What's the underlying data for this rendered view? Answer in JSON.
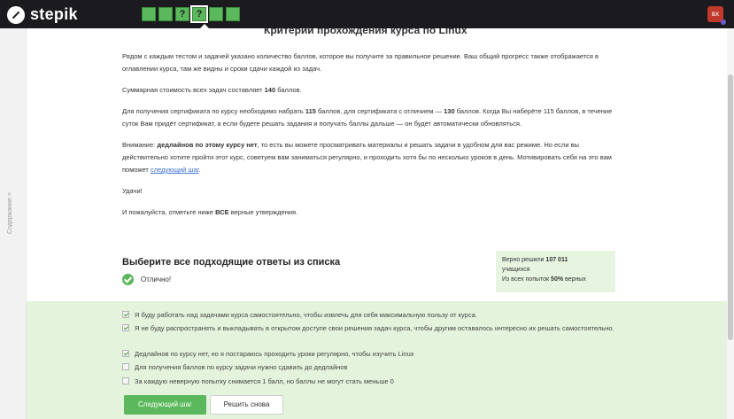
{
  "app": {
    "logo_text": "stepik",
    "avatar_initials": "вх"
  },
  "steps": [
    {
      "label": "",
      "active": false
    },
    {
      "label": "",
      "active": false
    },
    {
      "label": "?",
      "active": false
    },
    {
      "label": "?",
      "active": true
    },
    {
      "label": "",
      "active": false
    },
    {
      "label": "",
      "active": false
    }
  ],
  "sidebar": {
    "label": "Содержание >"
  },
  "lesson": {
    "title": "Критерии прохождения курса по Linux",
    "p1": "Рядом с каждым тестом и задачей указано количество баллов, которое вы получите за правильное решение. Ваш общий прогресс также отображается в оглавлении курса, там же видны и сроки сдачи каждой из задач.",
    "p2_a": "Суммарная стоимость всех задач составляет ",
    "p2_b": "140",
    "p2_c": " баллов.",
    "p3_a": "Для получения сертификата по курсу необходимо набрать ",
    "p3_b": "115",
    "p3_c": " баллов, для сертификата с отличием — ",
    "p3_d": "130",
    "p3_e": " баллов. Когда Вы наберёте 115 баллов, в течение суток Вам придёт сертификат, а если будете решать задания и получать баллы дальше — он будет автоматически обновляться.",
    "p4_a": "Внимание: ",
    "p4_b": "дедлайнов по этому курсу нет",
    "p4_c": ", то есть вы можете просматривать материалы и решать задачи в удобном для вас режиме. Но если вы действительно хотите пройти этот курс, советуем вам заниматься регулярно, и проходить хотя бы по несколько уроков в день. Мотивировать себя на это вам поможет ",
    "p4_link": "следующий шаг",
    "p4_d": ".",
    "p5": "Удачи!",
    "p6_a": "И пожалуйста, отметьте ниже ",
    "p6_b": "ВСЕ",
    "p6_c": " верные утверждения."
  },
  "quiz": {
    "heading": "Выберите все подходящие ответы из списка",
    "result": "Отлично!",
    "stats_a": "Верно решили ",
    "stats_b": "107 011",
    "stats_c": "учащихся",
    "stats_d": "Из всех попыток ",
    "stats_e": "50%",
    "stats_f": " верных"
  },
  "options": [
    {
      "text": "Я буду работать над задачами курса самостоятельно, чтобы извлечь для себя максимальную пользу от курса.",
      "checked": true
    },
    {
      "text": "Я не буду распространять и выкладывать в открытом доступе свои решения задач курса, чтобы другим оставалось интересно их решать самостоятельно.",
      "checked": true
    },
    {
      "text": "Дедлайнов по курсу нет, но я постараюсь проходить уроки регулярно, чтобы изучить Linux",
      "checked": true
    },
    {
      "text": "Для получения баллов по курсу задачи нужно сдавать до дедлайнов",
      "checked": false
    },
    {
      "text": "За каждую неверную попытку снимается 1 балл, но баллы не могут стать меньше 0",
      "checked": false
    }
  ],
  "buttons": {
    "next": "Следующий шаг",
    "retry": "Решить снова"
  },
  "colors": {
    "accent": "#5cb85c",
    "answer_bg": "#e3f3dc",
    "topbar": "#1b1b1f"
  }
}
